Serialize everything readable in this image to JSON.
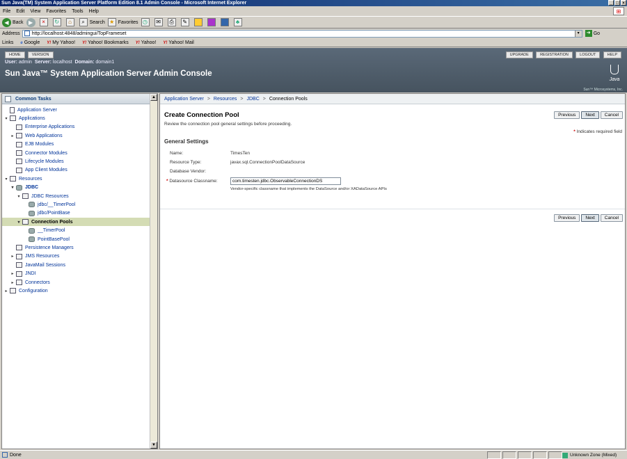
{
  "window": {
    "title": "Sun Java(TM) System Application Server Platform Edition 8.1 Admin Console - Microsoft Internet Explorer",
    "min": "_",
    "max": "□",
    "close": "×"
  },
  "menu": [
    "File",
    "Edit",
    "View",
    "Favorites",
    "Tools",
    "Help"
  ],
  "toolbar": {
    "back": "Back",
    "forward": "",
    "search": "Search",
    "favorites": "Favorites"
  },
  "address": {
    "label": "Address",
    "url": "http://localhost:4848/admingui/TopFrameset",
    "go": "Go"
  },
  "links": {
    "label": "Links",
    "items": [
      "Google",
      "My Yahoo!",
      "Yahoo! Bookmarks",
      "Yahoo!",
      "Yahoo! Mail"
    ]
  },
  "masthead": {
    "home": "HOME",
    "version": "VERSION",
    "upgrade": "UPGRADE",
    "registration": "REGISTRATION",
    "logout": "LOGOUT",
    "help": "HELP",
    "user_label": "User:",
    "user_value": "admin",
    "server_label": "Server:",
    "server_value": "localhost",
    "domain_label": "Domain:",
    "domain_value": "domain1",
    "title": "Sun Java™ System Application Server Admin Console",
    "java": "Java",
    "sun": "Sun™ Microsystems, Inc."
  },
  "tasks": {
    "header": "Common Tasks"
  },
  "tree": [
    {
      "label": "Application Server",
      "indent": 0,
      "toggle": "",
      "icon": "page"
    },
    {
      "label": "Applications",
      "indent": 0,
      "toggle": "▾",
      "icon": "folder"
    },
    {
      "label": "Enterprise Applications",
      "indent": 1,
      "toggle": "",
      "icon": "folder"
    },
    {
      "label": "Web Applications",
      "indent": 1,
      "toggle": "▸",
      "icon": "folder"
    },
    {
      "label": "EJB Modules",
      "indent": 1,
      "toggle": "",
      "icon": "folder"
    },
    {
      "label": "Connector Modules",
      "indent": 1,
      "toggle": "",
      "icon": "folder"
    },
    {
      "label": "Lifecycle Modules",
      "indent": 1,
      "toggle": "",
      "icon": "folder"
    },
    {
      "label": "App Client Modules",
      "indent": 1,
      "toggle": "",
      "icon": "folder"
    },
    {
      "label": "Resources",
      "indent": 0,
      "toggle": "▾",
      "icon": "folder"
    },
    {
      "label": "JDBC",
      "indent": 1,
      "toggle": "▾",
      "icon": "db",
      "bold": true
    },
    {
      "label": "JDBC Resources",
      "indent": 2,
      "toggle": "▾",
      "icon": "folder"
    },
    {
      "label": "jdbc/__TimerPool",
      "indent": 3,
      "toggle": "",
      "icon": "db"
    },
    {
      "label": "jdbc/PointBase",
      "indent": 3,
      "toggle": "",
      "icon": "db"
    },
    {
      "label": "Connection Pools",
      "indent": 2,
      "toggle": "▾",
      "icon": "folder",
      "selected": true
    },
    {
      "label": "__TimerPool",
      "indent": 3,
      "toggle": "",
      "icon": "db"
    },
    {
      "label": "PointBasePool",
      "indent": 3,
      "toggle": "",
      "icon": "db"
    },
    {
      "label": "Persistence Managers",
      "indent": 1,
      "toggle": "",
      "icon": "folder"
    },
    {
      "label": "JMS Resources",
      "indent": 1,
      "toggle": "▸",
      "icon": "folder"
    },
    {
      "label": "JavaMail Sessions",
      "indent": 1,
      "toggle": "",
      "icon": "folder"
    },
    {
      "label": "JNDI",
      "indent": 1,
      "toggle": "▸",
      "icon": "folder"
    },
    {
      "label": "Connectors",
      "indent": 1,
      "toggle": "▸",
      "icon": "folder"
    },
    {
      "label": "Configuration",
      "indent": 0,
      "toggle": "▸",
      "icon": "folder"
    }
  ],
  "breadcrumb": {
    "items": [
      "Application Server",
      "Resources",
      "JDBC"
    ],
    "current": "Connection Pools",
    "sep": ">"
  },
  "page": {
    "title": "Create Connection Pool",
    "help": "Review the connection pool general settings before proceeding.",
    "required_note": "Indicates required field",
    "required_mark": "*",
    "section": "General Settings",
    "buttons": {
      "previous": "Previous",
      "next": "Next",
      "cancel": "Cancel"
    },
    "fields": {
      "name_label": "Name:",
      "name_value": "TimesTen",
      "type_label": "Resource Type:",
      "type_value": "javax.sql.ConnectionPoolDataSource",
      "vendor_label": "Database Vendor:",
      "classname_label": "Datasource Classname:",
      "classname_value": "com.timesten.jdbc.ObservableConnectionDS",
      "classname_hint": "Vendor-specific classname that implements the DataSource and/or XADataSource APIs"
    }
  },
  "status": {
    "text": "Done",
    "zone": "Unknown Zone (Mixed)"
  }
}
